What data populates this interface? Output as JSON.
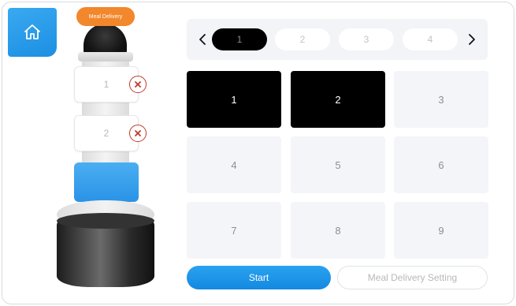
{
  "app": {
    "badge_label": "Meal Delivery"
  },
  "trays": [
    {
      "label": "1"
    },
    {
      "label": "2"
    }
  ],
  "pager": {
    "pages": [
      "1",
      "2",
      "3",
      "4"
    ],
    "active_page": "1"
  },
  "tables": [
    "1",
    "2",
    "3",
    "4",
    "5",
    "6",
    "7",
    "8",
    "9"
  ],
  "selected_tables": [
    "1",
    "2"
  ],
  "actions": {
    "start_label": "Start",
    "setting_label": "Meal Delivery Setting"
  },
  "colors": {
    "accent": "#1b8fe3",
    "badge": "#f2872b",
    "selected": "#000000",
    "remove": "#c0392b"
  },
  "icons": {
    "home": "home-icon",
    "remove": "close-circle-icon",
    "prev": "chevron-left-icon",
    "next": "chevron-right-icon"
  }
}
